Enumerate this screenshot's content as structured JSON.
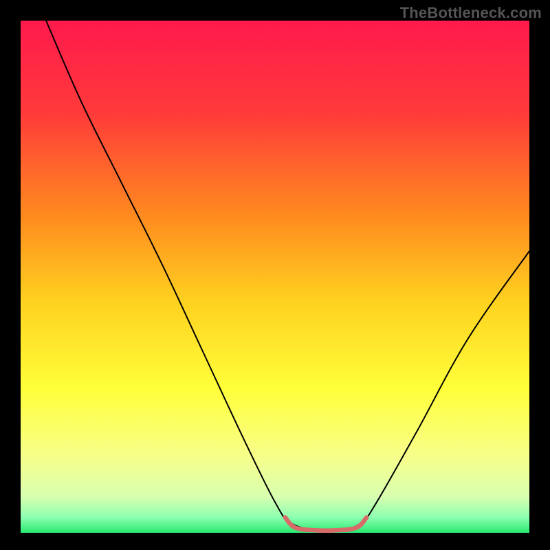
{
  "attribution": "TheBottleneck.com",
  "chart_data": {
    "type": "line",
    "title": "",
    "xlabel": "",
    "ylabel": "",
    "xlim": [
      0,
      100
    ],
    "ylim": [
      0,
      100
    ],
    "background_gradient": {
      "stops": [
        {
          "offset": 0.0,
          "color": "#ff1a4d"
        },
        {
          "offset": 0.18,
          "color": "#ff3a3a"
        },
        {
          "offset": 0.38,
          "color": "#ff8a1f"
        },
        {
          "offset": 0.55,
          "color": "#ffd21f"
        },
        {
          "offset": 0.72,
          "color": "#ffff3a"
        },
        {
          "offset": 0.85,
          "color": "#f7ff8a"
        },
        {
          "offset": 0.93,
          "color": "#d8ffb0"
        },
        {
          "offset": 0.97,
          "color": "#8cffb0"
        },
        {
          "offset": 1.0,
          "color": "#28e870"
        }
      ]
    },
    "series": [
      {
        "name": "bottleneck-curve",
        "color": "#000000",
        "width": 2.0,
        "points": [
          {
            "x": 5,
            "y": 100
          },
          {
            "x": 12,
            "y": 84
          },
          {
            "x": 20,
            "y": 68
          },
          {
            "x": 28,
            "y": 52
          },
          {
            "x": 36,
            "y": 35
          },
          {
            "x": 44,
            "y": 18
          },
          {
            "x": 50,
            "y": 6
          },
          {
            "x": 53,
            "y": 2
          },
          {
            "x": 58,
            "y": 0.5
          },
          {
            "x": 63,
            "y": 0.5
          },
          {
            "x": 67,
            "y": 2
          },
          {
            "x": 70,
            "y": 6
          },
          {
            "x": 78,
            "y": 20
          },
          {
            "x": 88,
            "y": 38
          },
          {
            "x": 100,
            "y": 55
          }
        ]
      },
      {
        "name": "optimal-zone-marker",
        "color": "#d96a6a",
        "width": 6.5,
        "points": [
          {
            "x": 52,
            "y": 3
          },
          {
            "x": 54,
            "y": 1
          },
          {
            "x": 58,
            "y": 0.5
          },
          {
            "x": 62,
            "y": 0.5
          },
          {
            "x": 66,
            "y": 1
          },
          {
            "x": 68,
            "y": 3
          }
        ]
      }
    ]
  }
}
